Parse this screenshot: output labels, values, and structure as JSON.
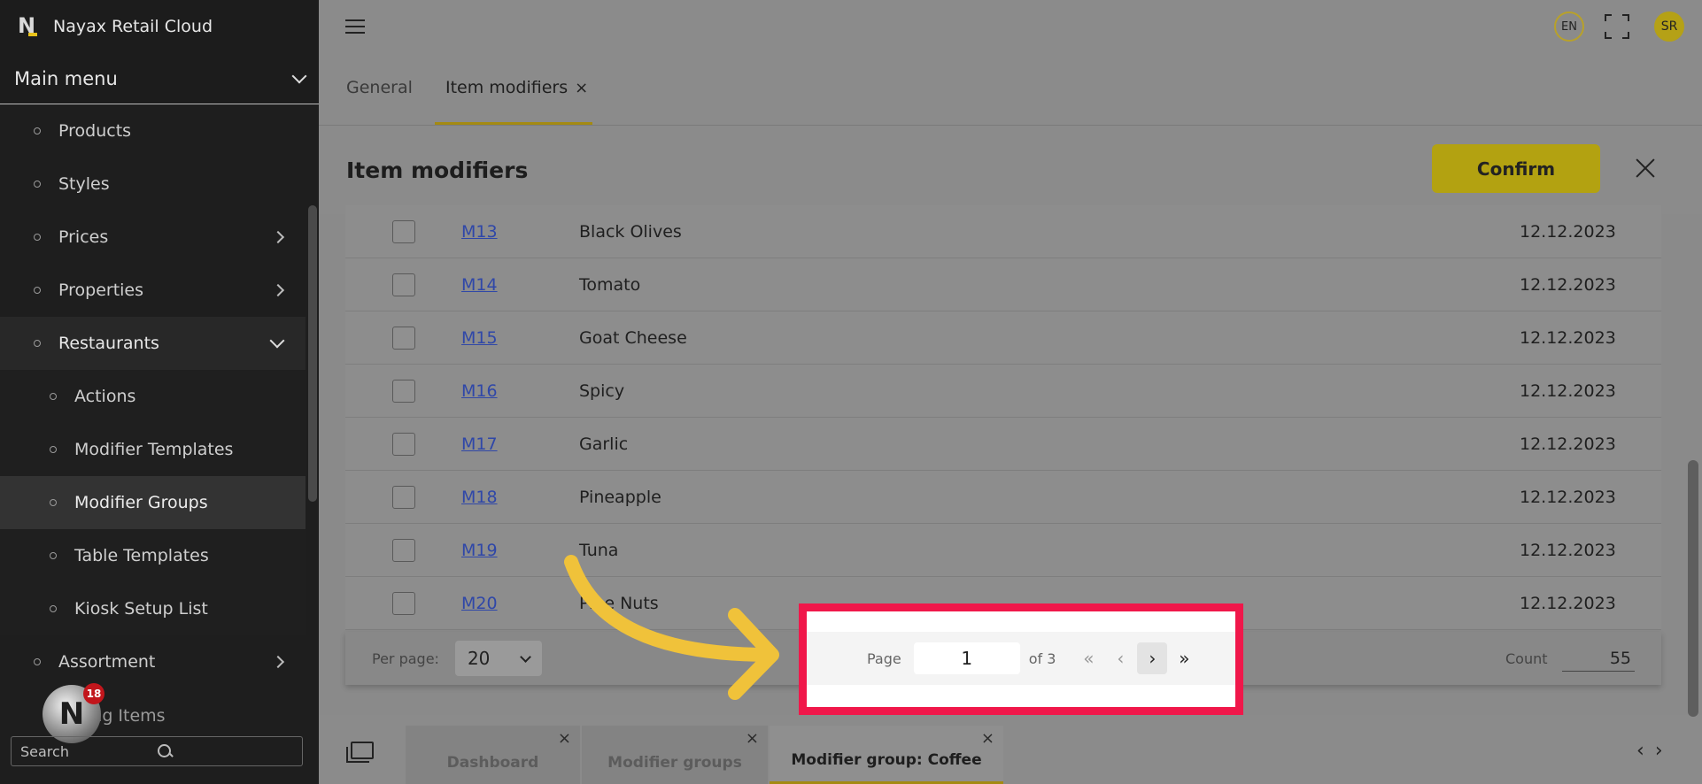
{
  "app": {
    "title": "Nayax Retail Cloud"
  },
  "sidebar": {
    "menu_label": "Main menu",
    "items": [
      {
        "label": "Products",
        "has_arrow": false
      },
      {
        "label": "Styles",
        "has_arrow": false
      },
      {
        "label": "Prices",
        "has_arrow": true
      },
      {
        "label": "Properties",
        "has_arrow": true
      },
      {
        "label": "Restaurants",
        "expanded": true
      },
      {
        "label": "Actions",
        "sub": true
      },
      {
        "label": "Modifier Templates",
        "sub": true
      },
      {
        "label": "Modifier Groups",
        "sub": true,
        "active": true
      },
      {
        "label": "Table Templates",
        "sub": true
      },
      {
        "label": "Kiosk Setup List",
        "sub": true
      },
      {
        "label": "Assortment",
        "has_arrow": true
      }
    ],
    "partial_item": "ing Items",
    "search_placeholder": "Search",
    "fab_letter": "N",
    "fab_badge": "18"
  },
  "topbar": {
    "lang": "EN",
    "avatar_initials": "SR"
  },
  "tabs": {
    "general": "General",
    "item_modifiers": "Item modifiers",
    "close": "×"
  },
  "modal": {
    "title": "Item modifiers",
    "confirm_label": "Confirm"
  },
  "table": {
    "rows": [
      {
        "code": "M13",
        "name": "Black Olives",
        "date": "12.12.2023"
      },
      {
        "code": "M14",
        "name": "Tomato",
        "date": "12.12.2023"
      },
      {
        "code": "M15",
        "name": "Goat Cheese",
        "date": "12.12.2023"
      },
      {
        "code": "M16",
        "name": "Spicy",
        "date": "12.12.2023"
      },
      {
        "code": "M17",
        "name": "Garlic",
        "date": "12.12.2023"
      },
      {
        "code": "M18",
        "name": "Pineapple",
        "date": "12.12.2023"
      },
      {
        "code": "M19",
        "name": "Tuna",
        "date": "12.12.2023"
      },
      {
        "code": "M20",
        "name": "Pine Nuts",
        "date": "12.12.2023"
      }
    ]
  },
  "footer": {
    "per_page_label": "Per page:",
    "per_page_value": "20",
    "page_label": "Page",
    "page_value": "1",
    "of_label": "of 3",
    "count_label": "Count",
    "count_value": "55"
  },
  "bottom_tabs": [
    {
      "label": "Dashboard"
    },
    {
      "label": "Modifier groups"
    },
    {
      "label": "Modifier group: Coffee",
      "active": true
    }
  ],
  "colors": {
    "accent": "#e8c21a",
    "highlight": "#f0174a",
    "link": "#2f47a8",
    "sidebar_bg": "#1e1e1e"
  }
}
